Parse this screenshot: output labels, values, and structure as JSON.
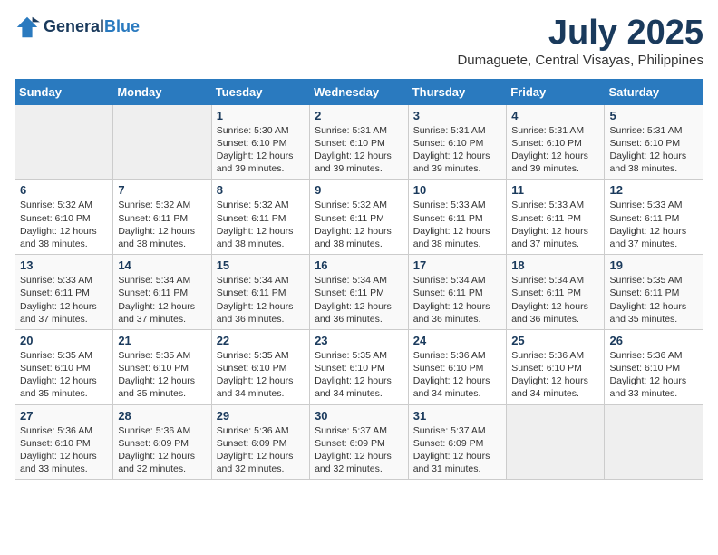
{
  "header": {
    "logo_general": "General",
    "logo_blue": "Blue",
    "month_title": "July 2025",
    "subtitle": "Dumaguete, Central Visayas, Philippines"
  },
  "days_of_week": [
    "Sunday",
    "Monday",
    "Tuesday",
    "Wednesday",
    "Thursday",
    "Friday",
    "Saturday"
  ],
  "weeks": [
    [
      {
        "day": "",
        "info": ""
      },
      {
        "day": "",
        "info": ""
      },
      {
        "day": "1",
        "info": "Sunrise: 5:30 AM\nSunset: 6:10 PM\nDaylight: 12 hours and 39 minutes."
      },
      {
        "day": "2",
        "info": "Sunrise: 5:31 AM\nSunset: 6:10 PM\nDaylight: 12 hours and 39 minutes."
      },
      {
        "day": "3",
        "info": "Sunrise: 5:31 AM\nSunset: 6:10 PM\nDaylight: 12 hours and 39 minutes."
      },
      {
        "day": "4",
        "info": "Sunrise: 5:31 AM\nSunset: 6:10 PM\nDaylight: 12 hours and 39 minutes."
      },
      {
        "day": "5",
        "info": "Sunrise: 5:31 AM\nSunset: 6:10 PM\nDaylight: 12 hours and 38 minutes."
      }
    ],
    [
      {
        "day": "6",
        "info": "Sunrise: 5:32 AM\nSunset: 6:10 PM\nDaylight: 12 hours and 38 minutes."
      },
      {
        "day": "7",
        "info": "Sunrise: 5:32 AM\nSunset: 6:11 PM\nDaylight: 12 hours and 38 minutes."
      },
      {
        "day": "8",
        "info": "Sunrise: 5:32 AM\nSunset: 6:11 PM\nDaylight: 12 hours and 38 minutes."
      },
      {
        "day": "9",
        "info": "Sunrise: 5:32 AM\nSunset: 6:11 PM\nDaylight: 12 hours and 38 minutes."
      },
      {
        "day": "10",
        "info": "Sunrise: 5:33 AM\nSunset: 6:11 PM\nDaylight: 12 hours and 38 minutes."
      },
      {
        "day": "11",
        "info": "Sunrise: 5:33 AM\nSunset: 6:11 PM\nDaylight: 12 hours and 37 minutes."
      },
      {
        "day": "12",
        "info": "Sunrise: 5:33 AM\nSunset: 6:11 PM\nDaylight: 12 hours and 37 minutes."
      }
    ],
    [
      {
        "day": "13",
        "info": "Sunrise: 5:33 AM\nSunset: 6:11 PM\nDaylight: 12 hours and 37 minutes."
      },
      {
        "day": "14",
        "info": "Sunrise: 5:34 AM\nSunset: 6:11 PM\nDaylight: 12 hours and 37 minutes."
      },
      {
        "day": "15",
        "info": "Sunrise: 5:34 AM\nSunset: 6:11 PM\nDaylight: 12 hours and 36 minutes."
      },
      {
        "day": "16",
        "info": "Sunrise: 5:34 AM\nSunset: 6:11 PM\nDaylight: 12 hours and 36 minutes."
      },
      {
        "day": "17",
        "info": "Sunrise: 5:34 AM\nSunset: 6:11 PM\nDaylight: 12 hours and 36 minutes."
      },
      {
        "day": "18",
        "info": "Sunrise: 5:34 AM\nSunset: 6:11 PM\nDaylight: 12 hours and 36 minutes."
      },
      {
        "day": "19",
        "info": "Sunrise: 5:35 AM\nSunset: 6:11 PM\nDaylight: 12 hours and 35 minutes."
      }
    ],
    [
      {
        "day": "20",
        "info": "Sunrise: 5:35 AM\nSunset: 6:10 PM\nDaylight: 12 hours and 35 minutes."
      },
      {
        "day": "21",
        "info": "Sunrise: 5:35 AM\nSunset: 6:10 PM\nDaylight: 12 hours and 35 minutes."
      },
      {
        "day": "22",
        "info": "Sunrise: 5:35 AM\nSunset: 6:10 PM\nDaylight: 12 hours and 34 minutes."
      },
      {
        "day": "23",
        "info": "Sunrise: 5:35 AM\nSunset: 6:10 PM\nDaylight: 12 hours and 34 minutes."
      },
      {
        "day": "24",
        "info": "Sunrise: 5:36 AM\nSunset: 6:10 PM\nDaylight: 12 hours and 34 minutes."
      },
      {
        "day": "25",
        "info": "Sunrise: 5:36 AM\nSunset: 6:10 PM\nDaylight: 12 hours and 34 minutes."
      },
      {
        "day": "26",
        "info": "Sunrise: 5:36 AM\nSunset: 6:10 PM\nDaylight: 12 hours and 33 minutes."
      }
    ],
    [
      {
        "day": "27",
        "info": "Sunrise: 5:36 AM\nSunset: 6:10 PM\nDaylight: 12 hours and 33 minutes."
      },
      {
        "day": "28",
        "info": "Sunrise: 5:36 AM\nSunset: 6:09 PM\nDaylight: 12 hours and 32 minutes."
      },
      {
        "day": "29",
        "info": "Sunrise: 5:36 AM\nSunset: 6:09 PM\nDaylight: 12 hours and 32 minutes."
      },
      {
        "day": "30",
        "info": "Sunrise: 5:37 AM\nSunset: 6:09 PM\nDaylight: 12 hours and 32 minutes."
      },
      {
        "day": "31",
        "info": "Sunrise: 5:37 AM\nSunset: 6:09 PM\nDaylight: 12 hours and 31 minutes."
      },
      {
        "day": "",
        "info": ""
      },
      {
        "day": "",
        "info": ""
      }
    ]
  ]
}
